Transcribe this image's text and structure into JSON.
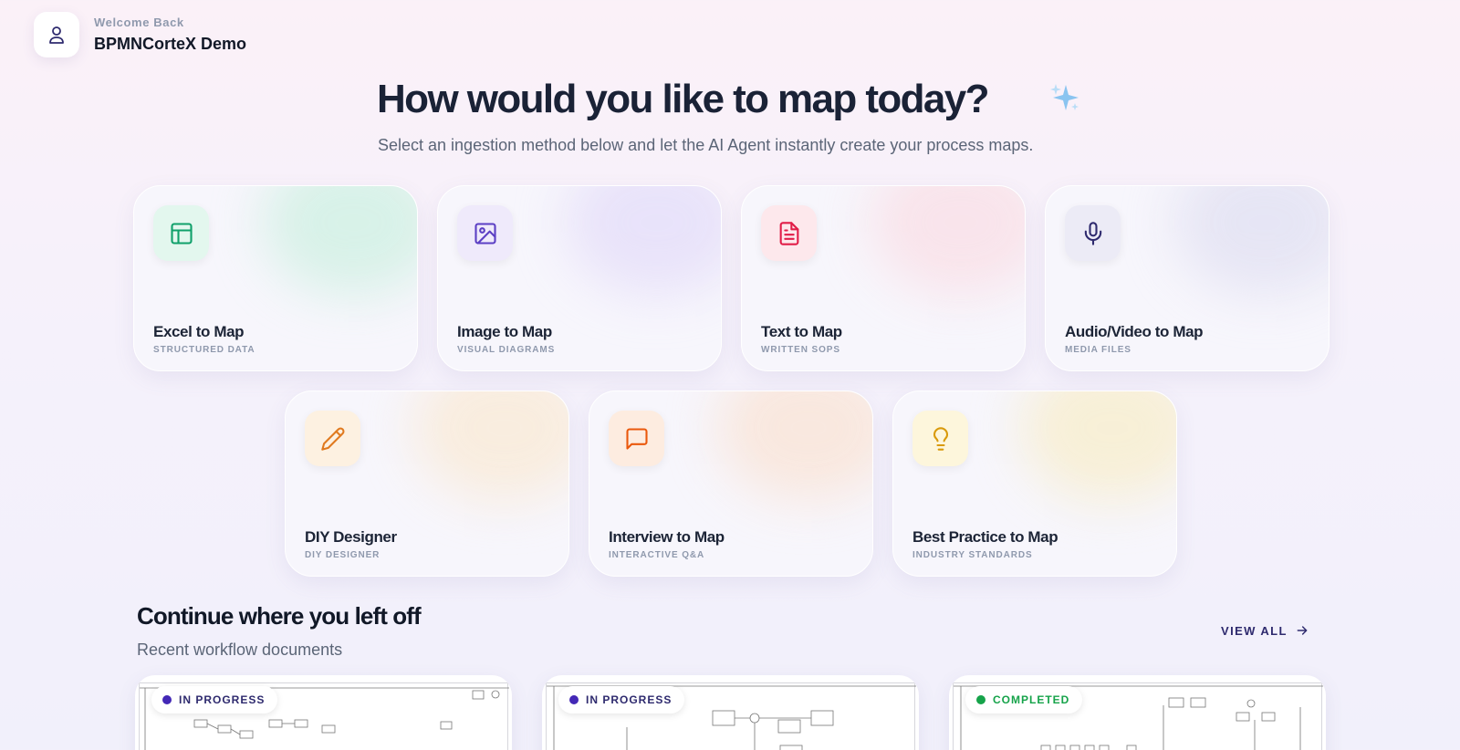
{
  "header": {
    "welcome": "Welcome Back",
    "user_name": "BPMNCorteX Demo",
    "avatar_icon": "user-icon"
  },
  "hero": {
    "title": "How would you like to map today?",
    "subtitle": "Select an ingestion method below and let the AI Agent instantly create your process maps.",
    "sparkle_icon": "sparkles-icon"
  },
  "methods": [
    {
      "title": "Excel to Map",
      "subtitle": "STRUCTURED DATA",
      "icon": "table-icon",
      "accent": "#10a06a",
      "icon_bg": "#e3f7ee"
    },
    {
      "title": "Image to Map",
      "subtitle": "VISUAL DIAGRAMS",
      "icon": "image-icon",
      "accent": "#5b3fc4",
      "icon_bg": "#efeafb"
    },
    {
      "title": "Text to Map",
      "subtitle": "WRITTEN SOPS",
      "icon": "file-text-icon",
      "accent": "#e11d48",
      "icon_bg": "#fde8ec"
    },
    {
      "title": "Audio/Video to Map",
      "subtitle": "MEDIA FILES",
      "icon": "microphone-icon",
      "accent": "#2e2a6e",
      "icon_bg": "#ecebf6"
    },
    {
      "title": "DIY Designer",
      "subtitle": "DIY DESIGNER",
      "icon": "pencil-icon",
      "accent": "#e07a1f",
      "icon_bg": "#fdf1e1"
    },
    {
      "title": "Interview to Map",
      "subtitle": "INTERACTIVE Q&A",
      "icon": "message-icon",
      "accent": "#ea580c",
      "icon_bg": "#fdece0"
    },
    {
      "title": "Best Practice to Map",
      "subtitle": "INDUSTRY STANDARDS",
      "icon": "lightbulb-icon",
      "accent": "#d99a0b",
      "icon_bg": "#fdf6dc"
    }
  ],
  "recent": {
    "title": "Continue where you left off",
    "subtitle": "Recent workflow documents",
    "view_all": "VIEW ALL",
    "docs": [
      {
        "status": "IN PROGRESS",
        "status_color": "#4328b6"
      },
      {
        "status": "IN PROGRESS",
        "status_color": "#4328b6"
      },
      {
        "status": "COMPLETED",
        "status_color": "#16a34a"
      }
    ]
  }
}
